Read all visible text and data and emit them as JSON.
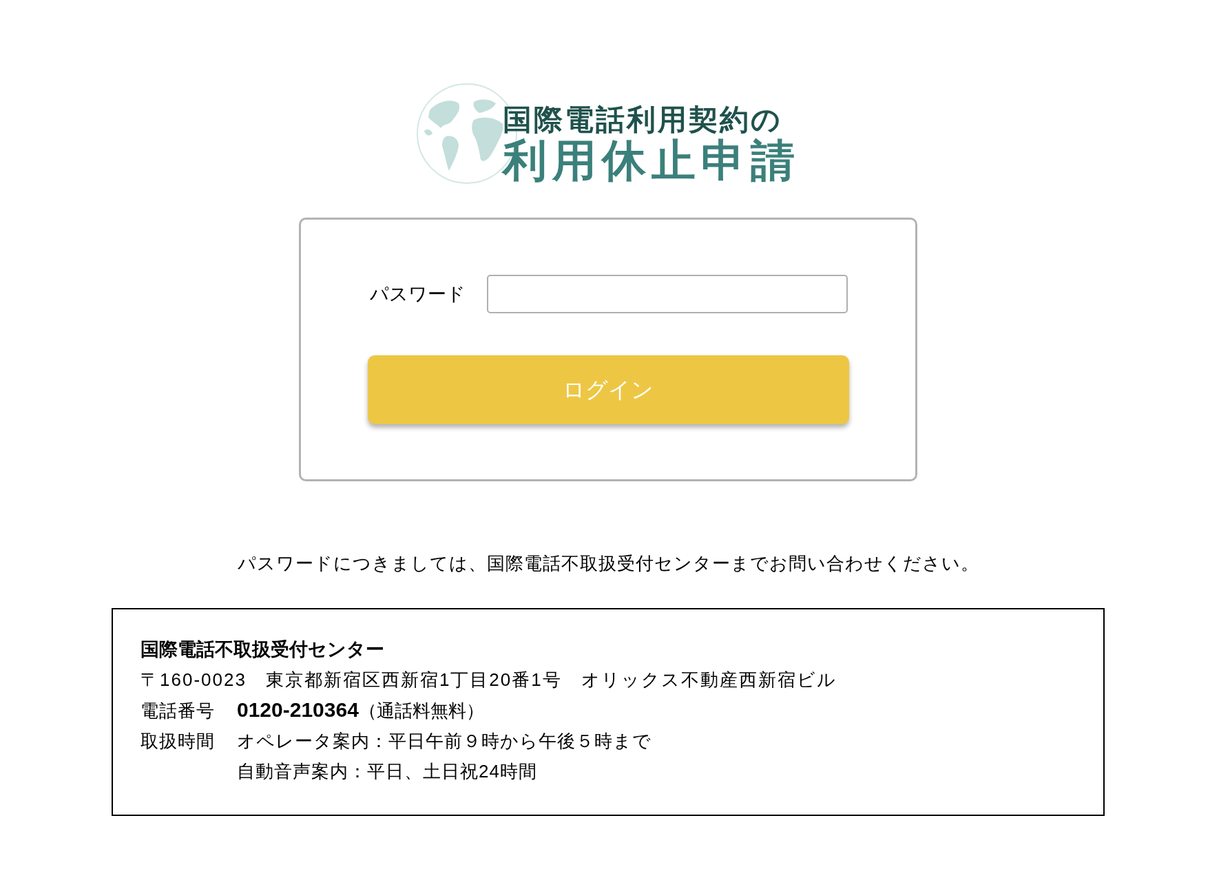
{
  "logo": {
    "line_1": "国際電話利用契約の",
    "line_2": "利用休止申請"
  },
  "login_form": {
    "fields": [
      {
        "kind": "password",
        "label": "パスワード"
      }
    ],
    "submit_button": "ログイン"
  },
  "notice": "パスワードにつきましては、国際電話不取扱受付センターまでお問い合わせください。",
  "contact_box": {
    "title": "国際電話不取扱受付センター",
    "address": "〒160-0023　東京都新宿区西新宿1丁目20番1号　オリックス不動産西新宿ビル",
    "rows": [
      {
        "kind": "phone",
        "label": "電話番号",
        "number": "0120-210364",
        "note": "（通話料無料）"
      },
      {
        "kind": "hours",
        "label": "取扱時間",
        "lines": [
          "オペレータ案内：平日午前９時から午後５時まで",
          "自動音声案内：平日、土日祝24時間"
        ]
      }
    ]
  }
}
